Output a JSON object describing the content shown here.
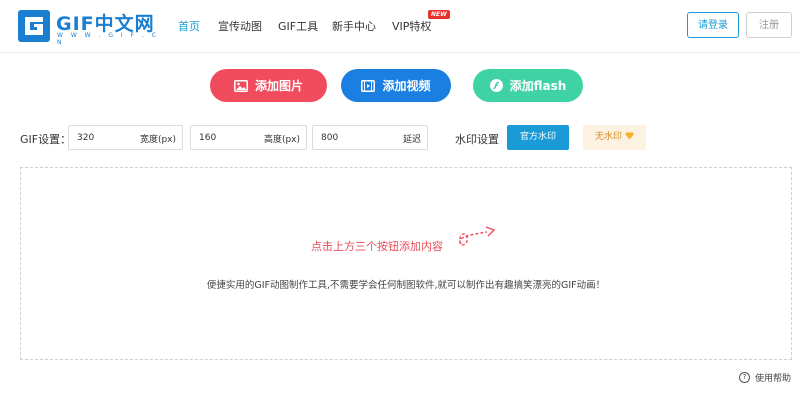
{
  "header": {
    "logo_text": "GIF中文网",
    "logo_sub": "W W W . G I F . C N",
    "nav": [
      "首页",
      "宣传动图",
      "GIF工具",
      "新手中心",
      "VIP特权"
    ],
    "vip_badge": "NEW",
    "login_label": "请登录",
    "register_label": "注册"
  },
  "actions": {
    "add_image": "添加图片",
    "add_video": "添加视频",
    "add_flash": "添加flash"
  },
  "settings": {
    "label": "GIF设置：",
    "width_value": "320",
    "width_unit": "宽度(px)",
    "height_value": "160",
    "height_unit": "高度(px)",
    "delay_value": "800",
    "delay_unit": "延迟",
    "watermark_label": "水印设置",
    "watermark_official": "官方水印",
    "watermark_none": "无水印"
  },
  "dropzone": {
    "hint": "点击上方三个按钮添加内容",
    "description": "便捷实用的GIF动图制作工具,不需要学会任何制图软件,就可以制作出有趣搞笑漂亮的GIF动画！"
  },
  "footer": {
    "help_label": "使用帮助"
  },
  "colors": {
    "brand": "#1a7fd1",
    "accent": "#1a9bd7",
    "red": "#f14c5e",
    "blue": "#1a7fe0",
    "green": "#3fd2a4"
  },
  "icons": {
    "image": "image-icon",
    "video": "film-icon",
    "flash": "flash-icon",
    "diamond": "diamond-icon",
    "help": "help-icon"
  }
}
